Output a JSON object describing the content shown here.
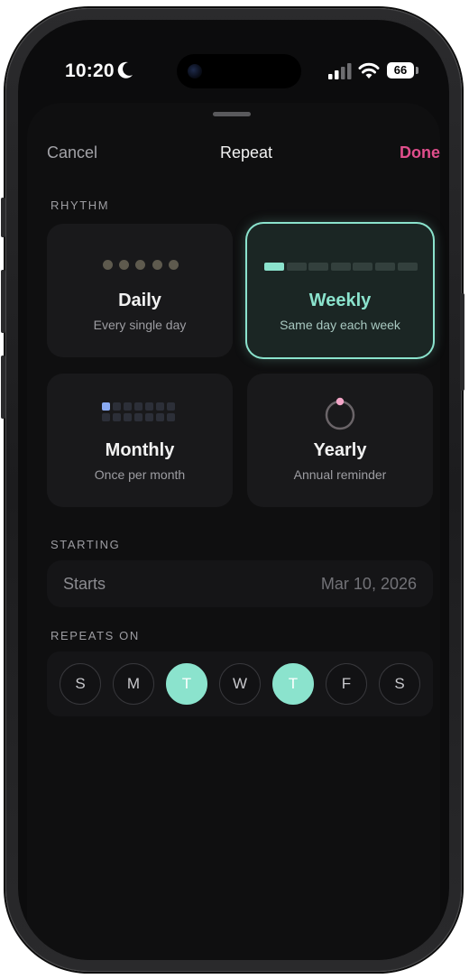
{
  "status_bar": {
    "time": "10:20",
    "battery": "66",
    "icons": [
      "moon-icon",
      "signal-icon",
      "wifi-icon",
      "battery-icon"
    ]
  },
  "nav": {
    "cancel": "Cancel",
    "title": "Repeat",
    "done": "Done"
  },
  "colors": {
    "accent_mint": "#8be3cd",
    "done_pink": "#e04e8c",
    "monthly_dot_blue": "#8aaaf2",
    "yearly_dot_pink": "#f3a6c8"
  },
  "rhythm": {
    "label": "RHYTHM",
    "options": [
      {
        "title": "Daily",
        "subtitle": "Every single day",
        "selected": false
      },
      {
        "title": "Weekly",
        "subtitle": "Same day each week",
        "selected": true
      },
      {
        "title": "Monthly",
        "subtitle": "Once per month",
        "selected": false
      },
      {
        "title": "Yearly",
        "subtitle": "Annual reminder",
        "selected": false
      }
    ]
  },
  "starting": {
    "label": "STARTING",
    "field_label": "Starts",
    "value": "Mar 10, 2026"
  },
  "repeats_on": {
    "label": "REPEATS ON",
    "days": [
      {
        "letter": "S",
        "selected": false
      },
      {
        "letter": "M",
        "selected": false
      },
      {
        "letter": "T",
        "selected": true
      },
      {
        "letter": "W",
        "selected": false
      },
      {
        "letter": "T",
        "selected": true
      },
      {
        "letter": "F",
        "selected": false
      },
      {
        "letter": "S",
        "selected": false
      }
    ]
  }
}
